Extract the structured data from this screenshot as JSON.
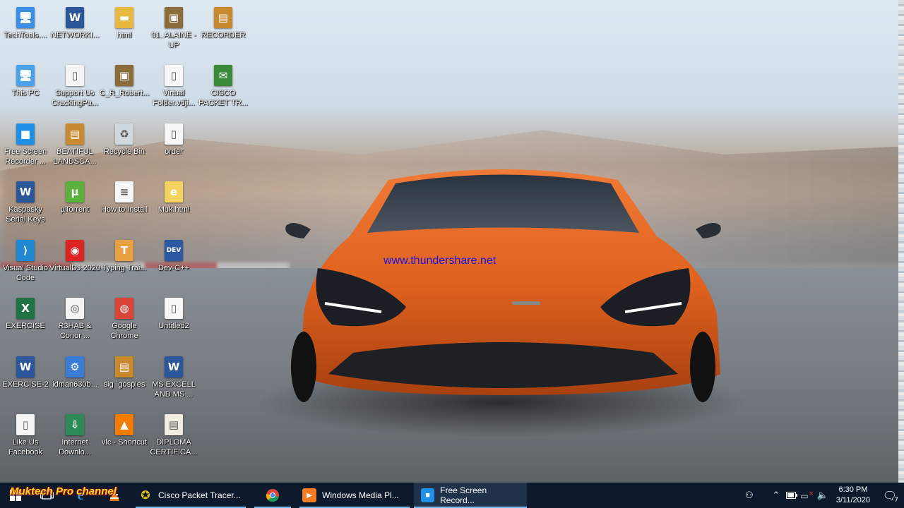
{
  "desktop": {
    "watermark_url": "www.thundershare.net",
    "icons": [
      {
        "label": "TechTools....",
        "icon": "pc-tools-icon"
      },
      {
        "label": "NETWORKI...",
        "icon": "word-doc-icon"
      },
      {
        "label": "html",
        "icon": "folder-icon"
      },
      {
        "label": "01. ALAINE - UP",
        "icon": "image-file-icon"
      },
      {
        "label": "RECORDER",
        "icon": "archive-icon"
      },
      {
        "label": "This PC",
        "icon": "this-pc-icon"
      },
      {
        "label": "Support Us CrackingPa...",
        "icon": "web-shortcut-icon"
      },
      {
        "label": "C_R_Robert...",
        "icon": "image-file-icon"
      },
      {
        "label": "Virtual Folder.vdji...",
        "icon": "blank-file-icon"
      },
      {
        "label": "CISCO PACKET TR...",
        "icon": "cisco-icon"
      },
      {
        "label": "Free Screen Recorder ...",
        "icon": "screen-recorder-icon"
      },
      {
        "label": "BEATIFUL LANDSCA...",
        "icon": "archive-icon"
      },
      {
        "label": "Recycle Bin",
        "icon": "recycle-bin-icon"
      },
      {
        "label": "order",
        "icon": "blank-file-icon"
      },
      {
        "label": "Kaspasky Serial Keys",
        "icon": "word-doc-icon"
      },
      {
        "label": "µTorrent",
        "icon": "utorrent-icon"
      },
      {
        "label": "How to Install",
        "icon": "text-file-icon"
      },
      {
        "label": "Muk.html",
        "icon": "html-file-icon"
      },
      {
        "label": "Visual Studio Code",
        "icon": "vscode-icon"
      },
      {
        "label": "VirtualDJ 2020",
        "icon": "virtualdj-icon"
      },
      {
        "label": "Typing Trai...",
        "icon": "typing-tutor-icon"
      },
      {
        "label": "Dev-C++",
        "icon": "devcpp-icon"
      },
      {
        "label": "EXERCISE",
        "icon": "excel-icon"
      },
      {
        "label": "R3HAB & Conor ...",
        "icon": "audio-file-icon"
      },
      {
        "label": "Google Chrome",
        "icon": "chrome-icon"
      },
      {
        "label": "Untitled2",
        "icon": "blank-file-icon"
      },
      {
        "label": "EXERCISE-2",
        "icon": "word-doc-icon"
      },
      {
        "label": "idman630b...",
        "icon": "installer-icon"
      },
      {
        "label": "sig `gosples",
        "icon": "archive-icon"
      },
      {
        "label": "MS EXCELL AND MS ...",
        "icon": "word-doc-icon"
      },
      {
        "label": "Like Us Facebook",
        "icon": "web-shortcut-icon"
      },
      {
        "label": "Internet Downlo...",
        "icon": "idm-icon"
      },
      {
        "label": "vlc - Shortcut",
        "icon": "vlc-icon"
      },
      {
        "label": "DIPLOMA CERTIFICA...",
        "icon": "certificate-icon"
      }
    ]
  },
  "taskbar": {
    "overlay_text": "Muktech Pro channel",
    "apps": [
      {
        "label": "Cisco Packet Tracer...",
        "icon": "cisco-icon"
      },
      {
        "label": "",
        "icon": "chrome-icon"
      },
      {
        "label": "Windows Media Pl...",
        "icon": "media-player-icon"
      },
      {
        "label": "Free Screen Record...",
        "icon": "screen-recorder-icon"
      }
    ],
    "clock": {
      "time": "6:30 PM",
      "date": "3/11/2020"
    },
    "notification_count": "7"
  },
  "colors": {
    "taskbar_bg": "#0d1a2d",
    "active_indicator": "#76b9ed",
    "car_orange": "#e0621f",
    "watermark_blue": "#1515e0"
  }
}
